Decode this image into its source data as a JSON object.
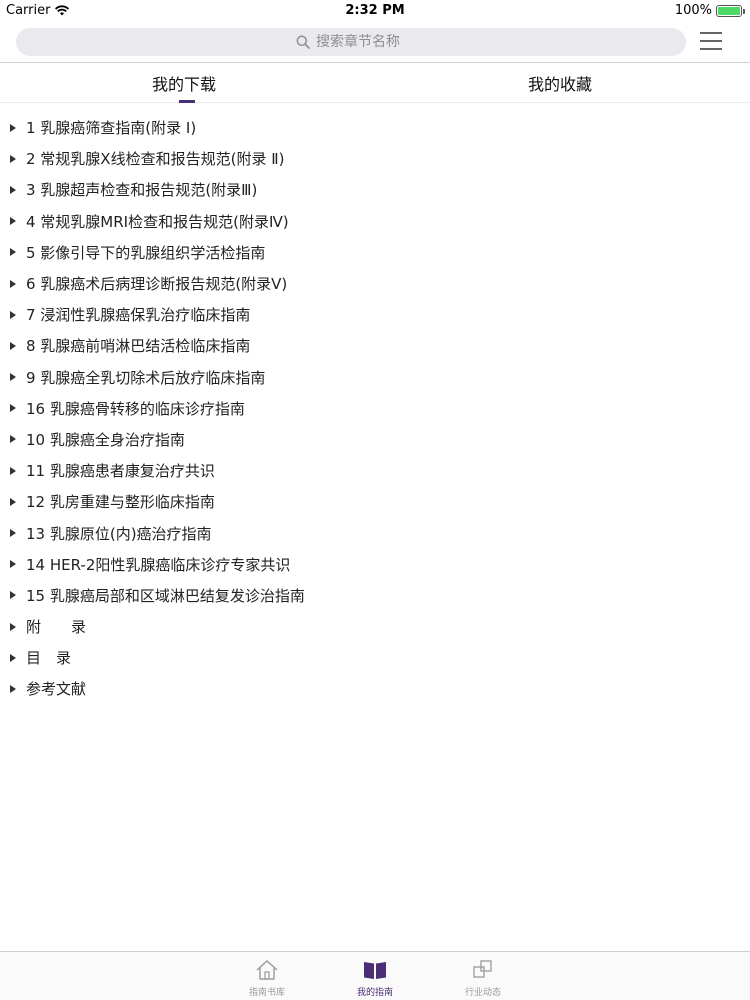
{
  "status_bar": {
    "carrier": "Carrier",
    "time": "2:32 PM",
    "battery": "100%",
    "battery_level": 1.0
  },
  "search": {
    "placeholder": "搜索章节名称"
  },
  "tabs": [
    {
      "label": "我的下载",
      "active": true
    },
    {
      "label": "我的收藏",
      "active": false
    }
  ],
  "chapters": [
    "1 乳腺癌筛查指南(附录 Ⅰ)",
    "2 常规乳腺X线检查和报告规范(附录 Ⅱ)",
    "3 乳腺超声检查和报告规范(附录Ⅲ)",
    "4 常规乳腺MRI检查和报告规范(附录Ⅳ)",
    "5 影像引导下的乳腺组织学活检指南",
    "6 乳腺癌术后病理诊断报告规范(附录Ⅴ)",
    "7 浸润性乳腺癌保乳治疗临床指南",
    "8 乳腺癌前哨淋巴结活检临床指南",
    "9 乳腺癌全乳切除术后放疗临床指南",
    "16 乳腺癌骨转移的临床诊疗指南",
    "10 乳腺癌全身治疗指南",
    "11 乳腺癌患者康复治疗共识",
    "12 乳房重建与整形临床指南",
    "13 乳腺原位(内)癌治疗指南",
    "14 HER-2阳性乳腺癌临床诊疗专家共识",
    "15 乳腺癌局部和区域淋巴结复发诊治指南",
    "附　　录",
    "目　录",
    "参考文献"
  ],
  "tabbar": [
    {
      "label": "指南书库",
      "icon": "house-icon",
      "active": false
    },
    {
      "label": "我的指南",
      "icon": "book-icon",
      "active": true
    },
    {
      "label": "行业动态",
      "icon": "squares-icon",
      "active": false
    }
  ],
  "colors": {
    "accent": "#4b2e75",
    "battery": "#4cd964"
  }
}
